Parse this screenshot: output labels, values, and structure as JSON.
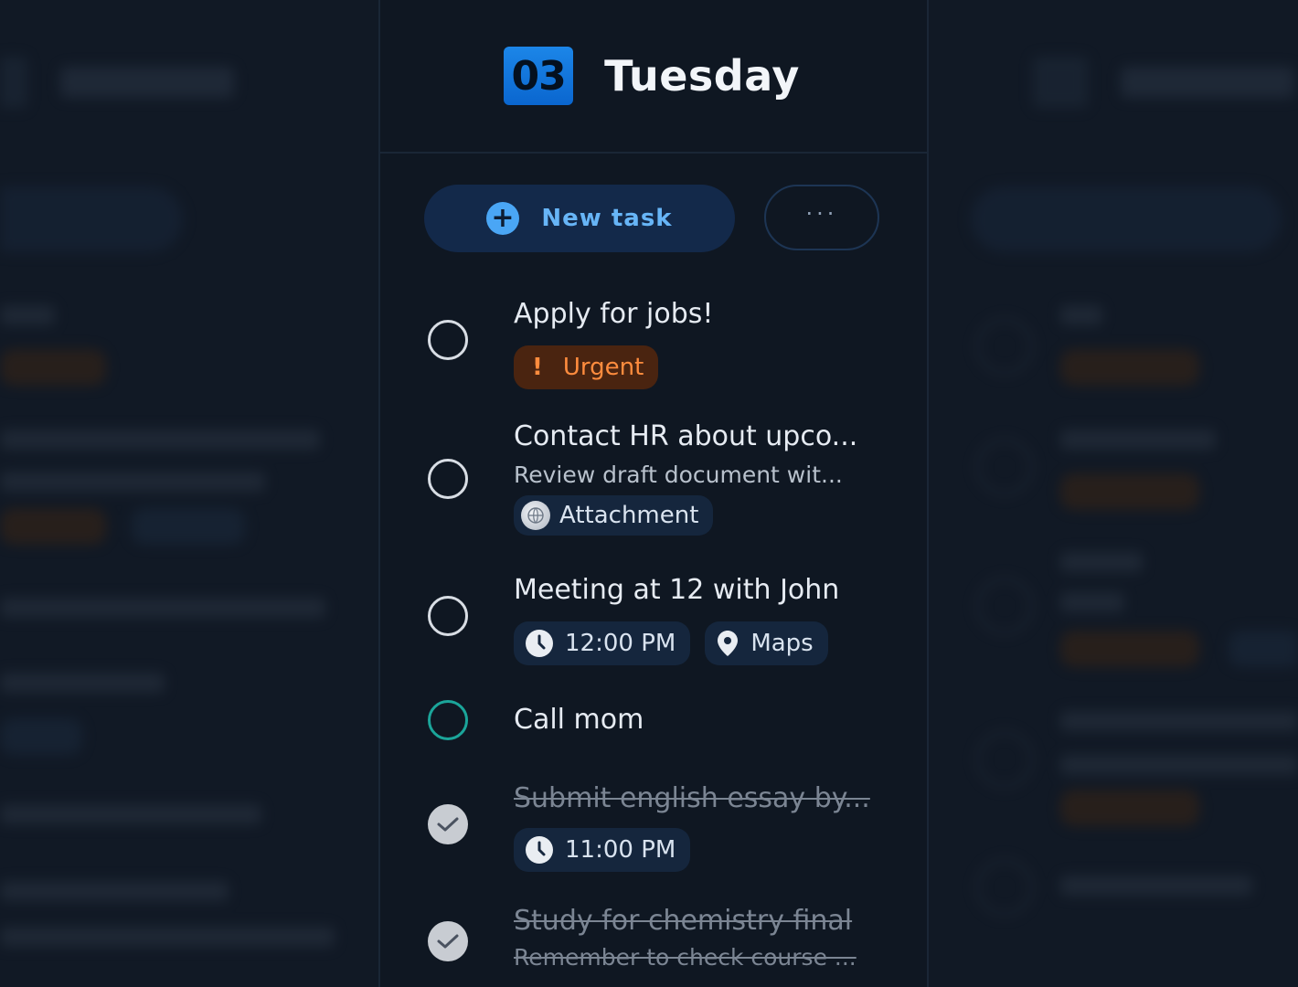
{
  "day": {
    "number": "03",
    "name": "Tuesday"
  },
  "toolbar": {
    "new_task_label": "New task",
    "more_label": "···"
  },
  "tasks": [
    {
      "title": "Apply for jobs!",
      "status": "open",
      "tags": [
        {
          "kind": "urgent",
          "label": "Urgent",
          "icon": "exclamation-icon"
        }
      ]
    },
    {
      "title": "Contact HR about upco...",
      "subtitle": "Review draft document wit...",
      "status": "open",
      "tags": [
        {
          "kind": "attachment",
          "label": "Attachment",
          "icon": "globe-icon"
        }
      ]
    },
    {
      "title": "Meeting at 12 with John",
      "status": "open",
      "tags": [
        {
          "kind": "time",
          "label": "12:00 PM",
          "icon": "clock-icon"
        },
        {
          "kind": "location",
          "label": "Maps",
          "icon": "map-pin-icon"
        }
      ]
    },
    {
      "title": "Call mom",
      "status": "open-highlighted"
    },
    {
      "title": "Submit english essay by...",
      "status": "done",
      "tags": [
        {
          "kind": "time",
          "label": "11:00 PM",
          "icon": "clock-icon"
        }
      ]
    },
    {
      "title": "Study for chemistry final",
      "subtitle": "Remember to check course ...",
      "status": "done"
    }
  ],
  "colors": {
    "accent_blue": "#1c86e8",
    "urgent_orange": "#ff8c3e",
    "call_ring_teal": "#1ba59a",
    "background": "#111925"
  }
}
